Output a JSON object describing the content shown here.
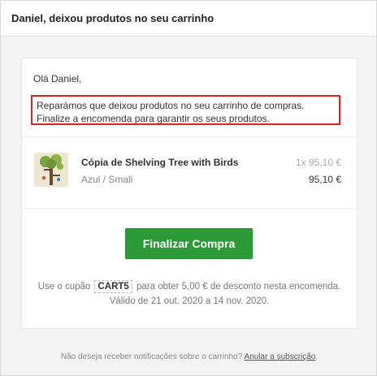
{
  "email": {
    "subject": "Daniel, deixou produtos no seu carrinho",
    "greeting": "Olá Daniel,",
    "message": "Reparámos que deixou produtos no seu carrinho de compras. Finalize a encomenda para garantir os seus produtos."
  },
  "cart": {
    "items": [
      {
        "title": "Cópia de Shelving Tree with Birds",
        "variant": "Azul / Small",
        "quantity_price": "1x 95,10 €",
        "total": "95,10 €",
        "icon": "tree-shelf-thumbnail"
      }
    ]
  },
  "cta": {
    "label": "Finalizar Compra",
    "color": "#2c9a37"
  },
  "coupon": {
    "prefix": "Use o cupão",
    "code": "CART5",
    "suffix": "para obter 5,00 € de desconto nesta encomenda.",
    "validity": "Válido de 21 out. 2020 a 14 nov. 2020."
  },
  "footer": {
    "text": "Não deseja receber notificações sobre o carrinho?",
    "unsubscribe_link": "Anular a subscrição",
    "trailing": "."
  },
  "colors": {
    "highlight_border": "#e0231a",
    "button": "#2c9a37"
  }
}
